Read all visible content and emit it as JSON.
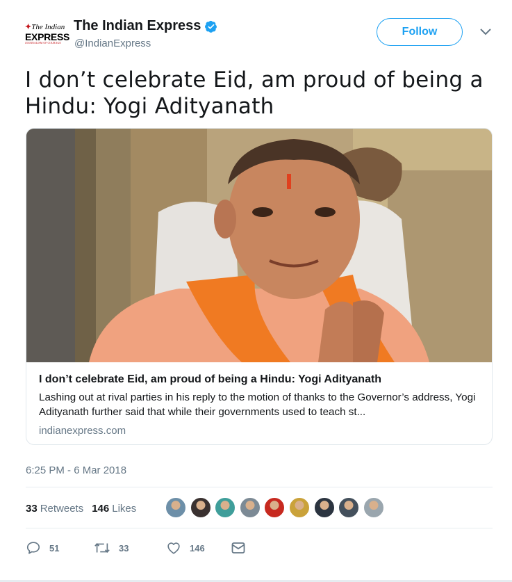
{
  "author": {
    "logo_line1": "The Indian",
    "logo_line2": "EXPRESS",
    "logo_line3": "JOURNALISM OF COURAGE",
    "name": "The Indian Express",
    "handle": "@IndianExpress",
    "verified": true
  },
  "follow_label": "Follow",
  "tweet_text": "I don’t celebrate Eid, am proud of being a Hindu: Yogi Adityanath",
  "card": {
    "image_alt": "Photo of Yogi Adityanath with folded hands wearing an orange stole",
    "title": "I don’t celebrate Eid, am proud of being a Hindu: Yogi Adityanath",
    "description": "Lashing out at rival parties in his reply to the motion of thanks to the Governor’s address, Yogi Adityanath further said that while their governments used to teach st...",
    "domain": "indianexpress.com"
  },
  "timestamp": "6:25 PM - 6 Mar 2018",
  "stats": {
    "retweets_count": "33",
    "retweets_label": "Retweets",
    "likes_count": "146",
    "likes_label": "Likes"
  },
  "liker_avatar_colors": [
    "#6d8fa8",
    "#3a3130",
    "#3f9e9a",
    "#7c8a95",
    "#c7291f",
    "#caa23a",
    "#2b3440",
    "#44505c",
    "#9aa6ae"
  ],
  "actions": {
    "reply_count": "51",
    "retweet_count": "33",
    "like_count": "146"
  },
  "colors": {
    "accent": "#1da1f2",
    "text": "#14171a",
    "secondary": "#657786",
    "border": "#e1e8ed"
  }
}
